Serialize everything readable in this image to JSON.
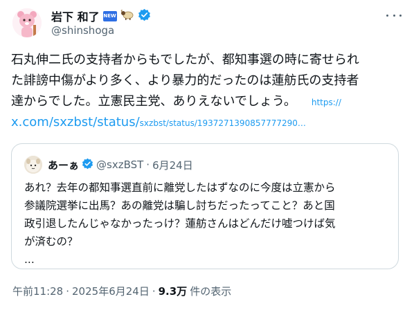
{
  "author": {
    "display_name": "岩下 和了",
    "handle": "@shinshoga",
    "badge_new": "NEW"
  },
  "tweet": {
    "lines": [
      "石丸伸二氏の支持者からもでしたが、都知事選の時に寄せられ",
      "た誹謗中傷がより多く、より暴力的だったのは蓮舫氏の支持者",
      "達からでした。立憲民主党、ありえないでしょう。"
    ],
    "link_prefix": "https://",
    "link_domain": "x.com/sxzbst/status/",
    "link_path": "sxzbst/status/1937271390857777290…"
  },
  "quote": {
    "display_name": "あーぁ",
    "handle": "@sxzBST",
    "separator": "·",
    "date": "6月24日",
    "lines": [
      "あれ？去年の都知事選直前に離党したはずなのに今度は立憲から",
      "参議院選挙に出馬？あの離党は騙し討ちだったってこと？あと国",
      "政引退したんじゃなかったっけ？蓮舫さんはどんだけ嘘つけば気",
      "が済むの？",
      "..."
    ]
  },
  "footer": {
    "time": "午前11:28",
    "sep1": "·",
    "date": "2025年6月24日",
    "sep2": "·",
    "views": "9.3万",
    "views_label": "件の表示"
  },
  "colors": {
    "verified": "#1d9bf0",
    "link": "#1d9bf0",
    "secondary_text": "#536471",
    "border": "#cfd9de"
  }
}
